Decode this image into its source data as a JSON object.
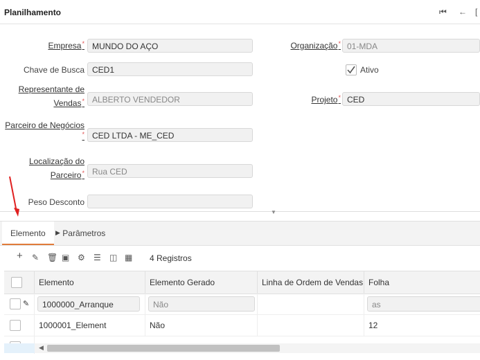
{
  "window": {
    "title": "Planilhamento",
    "nav_first_icon": "first-record-icon",
    "nav_back_icon": "arrow-left-icon"
  },
  "form": {
    "empresa": {
      "label": "Empresa",
      "value": "MUNDO DO AÇO"
    },
    "organizacao": {
      "label": "Organização",
      "value": "01-MDA"
    },
    "chave_busca": {
      "label": "Chave de Busca",
      "value": "CED1"
    },
    "ativo": {
      "label": "Ativo",
      "checked": true
    },
    "representante": {
      "label_line1": "Representante de",
      "label_line2": "Vendas",
      "value": "ALBERTO VENDEDOR"
    },
    "projeto": {
      "label": "Projeto",
      "value": "CED"
    },
    "parceiro": {
      "label": "Parceiro de Negócios",
      "value": "CED LTDA - ME_CED"
    },
    "localizacao": {
      "label_line1": "Localização do",
      "label_line2": "Parceiro",
      "value": "Rua CED"
    },
    "peso_desconto": {
      "label": "Peso Desconto",
      "value": ""
    }
  },
  "tabs": [
    {
      "label": "Elemento",
      "active": true
    },
    {
      "label": "Parâmetros",
      "active": false
    }
  ],
  "toolbar": {
    "icons": [
      "add-icon",
      "edit-icon",
      "delete-icon",
      "save-icon",
      "settings-icon",
      "list-icon",
      "split-view-icon",
      "grid-icon"
    ],
    "records": "4 Registros"
  },
  "grid": {
    "columns": [
      "Elemento",
      "Elemento Gerado",
      "Linha de Ordem de Vendas",
      "Folha"
    ],
    "rows": [
      {
        "elemento": "1000000_Arranque",
        "gerado": "Não",
        "linha": "",
        "folha": "as"
      },
      {
        "elemento": "1000001_Element",
        "gerado": "Não",
        "linha": "",
        "folha": "12"
      }
    ]
  },
  "colors": {
    "accent": "#e07b39",
    "required": "#e05050",
    "annotation_arrow": "#e02020"
  }
}
